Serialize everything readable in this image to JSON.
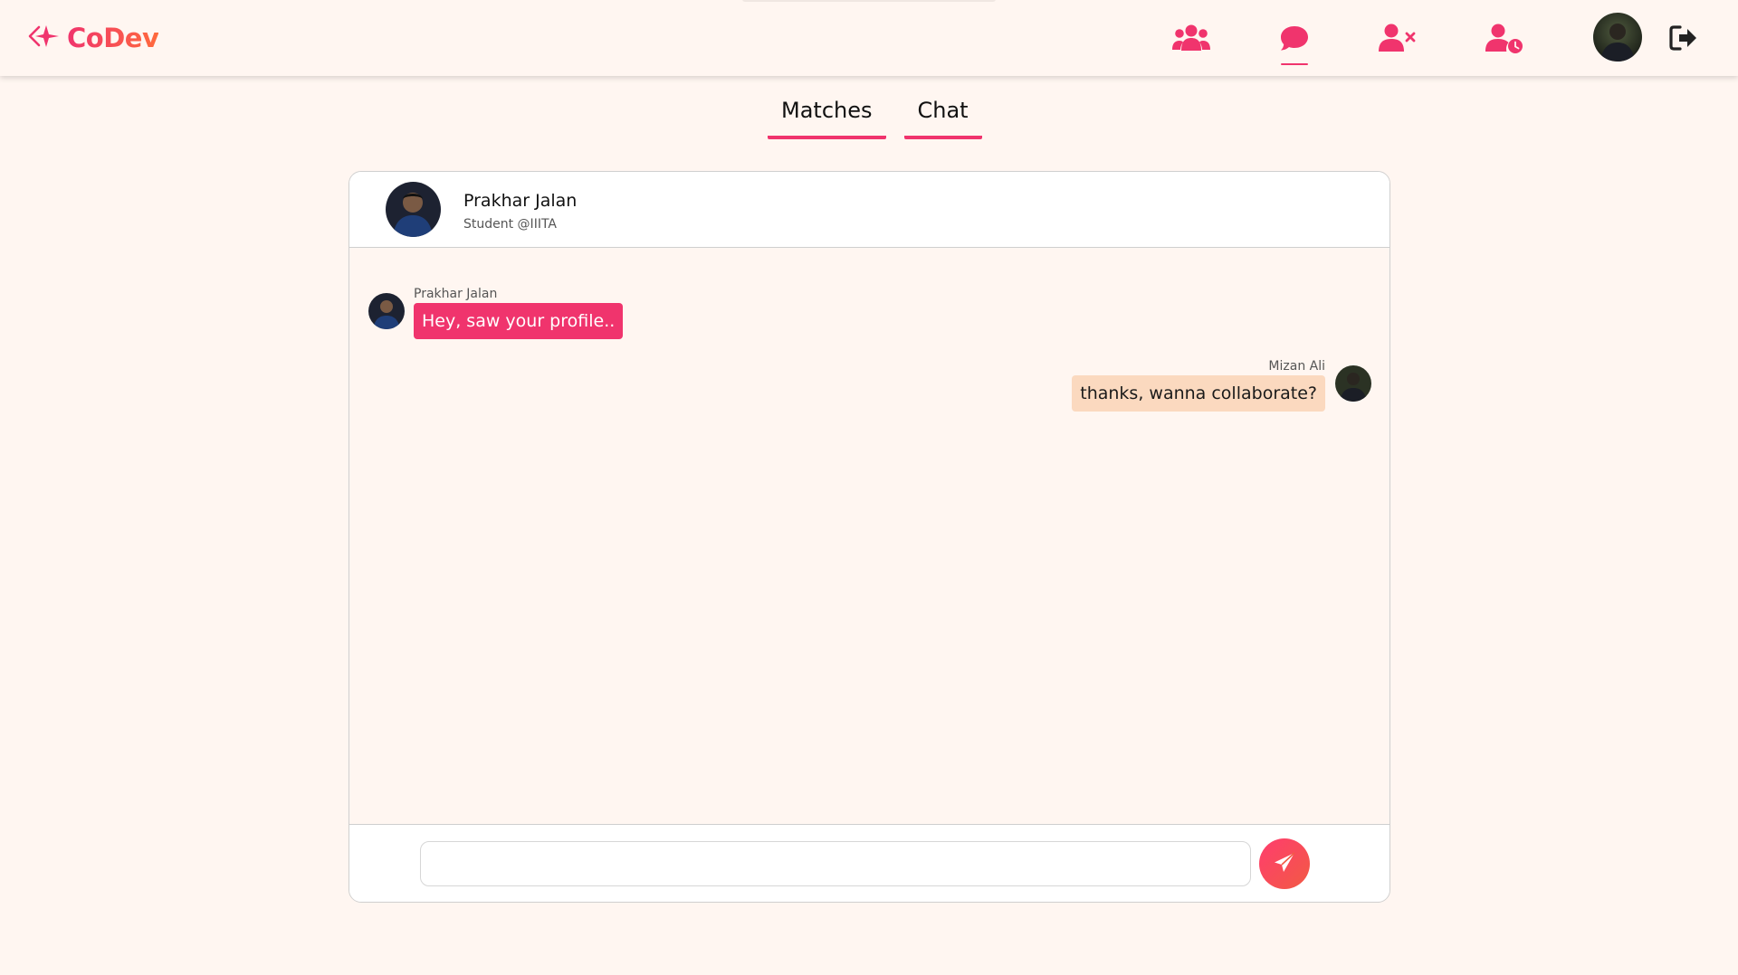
{
  "app": {
    "brand": "CoDev",
    "accent_color": "#f0346d",
    "background_color": "#fff6f1"
  },
  "navbar": {
    "icons": [
      {
        "name": "users-icon",
        "active": false
      },
      {
        "name": "chat-icon",
        "active": true
      },
      {
        "name": "user-x-icon",
        "active": false
      },
      {
        "name": "user-clock-icon",
        "active": false
      }
    ],
    "avatar": "user-avatar",
    "logout_icon": "logout-icon"
  },
  "tabs": [
    {
      "label": "Matches"
    },
    {
      "label": "Chat"
    }
  ],
  "chat": {
    "contact_name": "Prakhar Jalan",
    "contact_subtitle": "Student @IIITA",
    "messages": [
      {
        "sender": "Prakhar Jalan",
        "text": "Hey, saw your profile..",
        "direction": "incoming"
      },
      {
        "sender": "Mizan Ali",
        "text": "thanks, wanna collaborate?",
        "direction": "outgoing"
      }
    ],
    "input_value": "",
    "input_placeholder": "",
    "send_icon": "send-icon"
  }
}
